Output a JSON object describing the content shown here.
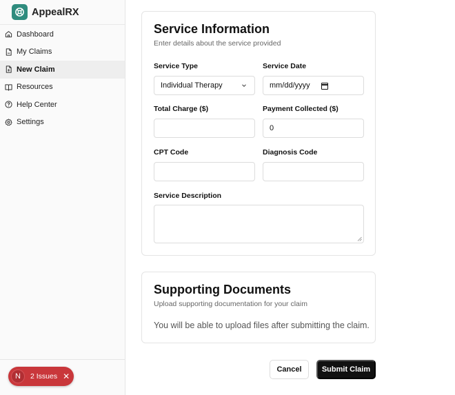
{
  "app": {
    "name": "AppealRX"
  },
  "sidebar": {
    "items": [
      {
        "label": "Dashboard",
        "icon": "home-icon"
      },
      {
        "label": "My Claims",
        "icon": "file-icon"
      },
      {
        "label": "New Claim",
        "icon": "file-plus-icon",
        "active": true
      },
      {
        "label": "Resources",
        "icon": "book-open-icon"
      },
      {
        "label": "Help Center",
        "icon": "help-circle-icon"
      },
      {
        "label": "Settings",
        "icon": "gear-icon"
      }
    ]
  },
  "issues_badge": {
    "initial": "N",
    "label": "2 Issues",
    "close": "✕"
  },
  "service_info": {
    "title": "Service Information",
    "subtitle": "Enter details about the service provided",
    "service_type": {
      "label": "Service Type",
      "value": "Individual Therapy"
    },
    "service_date": {
      "label": "Service Date",
      "value": "mm/dd/yyyy"
    },
    "total_charge": {
      "label": "Total Charge ($)",
      "value": ""
    },
    "payment_collected": {
      "label": "Payment Collected ($)",
      "value": "0"
    },
    "cpt_code": {
      "label": "CPT Code",
      "value": ""
    },
    "diagnosis_code": {
      "label": "Diagnosis Code",
      "value": ""
    },
    "service_description": {
      "label": "Service Description",
      "value": ""
    }
  },
  "supporting_docs": {
    "title": "Supporting Documents",
    "subtitle": "Upload supporting documentation for your claim",
    "note": "You will be able to upload files after submitting the claim."
  },
  "actions": {
    "cancel": "Cancel",
    "submit": "Submit Claim"
  },
  "colors": {
    "brand": "#2f8c7e",
    "submit_bg": "#111111",
    "issues_bg": "#c9373b"
  }
}
